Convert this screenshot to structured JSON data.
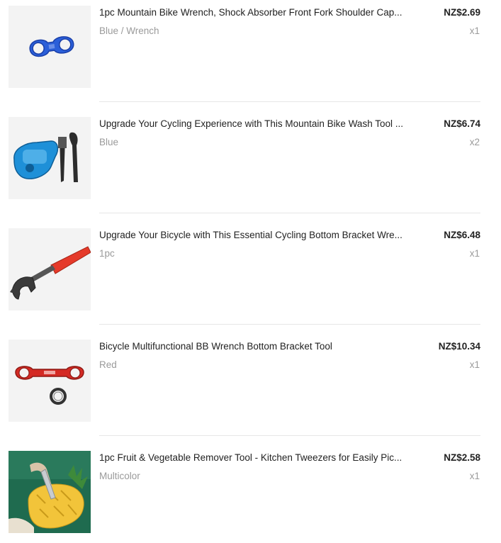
{
  "order_items": [
    {
      "title": "1pc Mountain Bike Wrench, Shock Absorber Front Fork Shoulder Cap...",
      "variant": "Blue / Wrench",
      "price": "NZ$2.69",
      "quantity": "x1",
      "image_icon": "blue-fork-wrench-icon"
    },
    {
      "title": "Upgrade Your Cycling Experience with This Mountain Bike Wash Tool ...",
      "variant": "Blue",
      "price": "NZ$6.74",
      "quantity": "x2",
      "image_icon": "chain-cleaner-brushes-icon"
    },
    {
      "title": "Upgrade Your Bicycle with This Essential Cycling Bottom Bracket Wre...",
      "variant": "1pc",
      "price": "NZ$6.48",
      "quantity": "x1",
      "image_icon": "bottom-bracket-wrench-icon"
    },
    {
      "title": "Bicycle Multifunctional BB Wrench Bottom Bracket Tool",
      "variant": "Red",
      "price": "NZ$10.34",
      "quantity": "x1",
      "image_icon": "red-bb-wrench-icon"
    },
    {
      "title": "1pc Fruit & Vegetable Remover Tool - Kitchen Tweezers for Easily Pic...",
      "variant": "Multicolor",
      "price": "NZ$2.58",
      "quantity": "x1",
      "image_icon": "pineapple-tool-icon"
    }
  ],
  "colors": {
    "text_primary": "#222222",
    "text_secondary": "#9a9a9a",
    "divider": "#e6e6e6",
    "thumb_bg": "#f3f3f3"
  }
}
